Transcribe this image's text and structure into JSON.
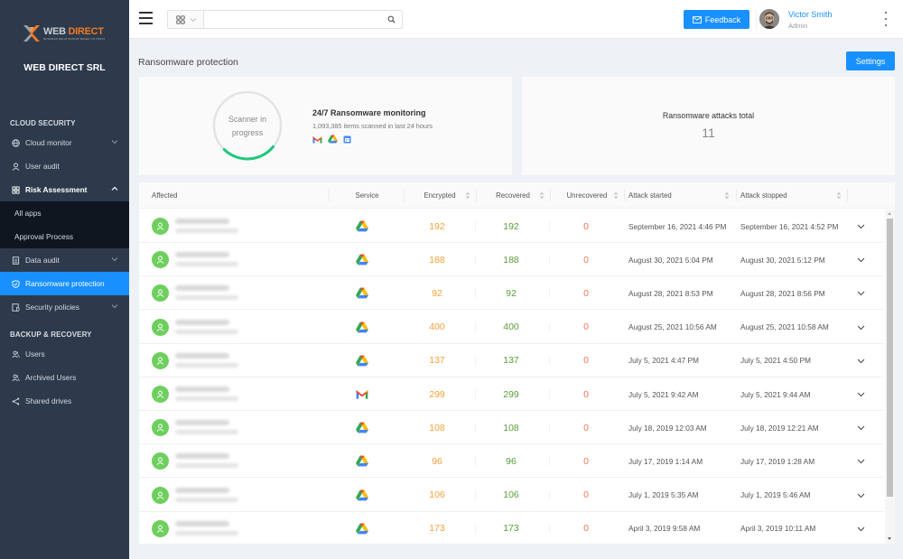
{
  "brand": {
    "logo_text_web": "WEB",
    "logo_text_direct": "DIRECT",
    "logo_tagline": "BUSINESS RELATIONSHIP BASED ON TRUST",
    "company_name": "WEB DIRECT SRL",
    "accent_color": "#1890ff",
    "logo_orange": "#f07a24"
  },
  "sidebar": {
    "sections": [
      {
        "label": "CLOUD SECURITY"
      },
      {
        "label": "BACKUP & RECOVERY"
      }
    ],
    "items": [
      {
        "label": "Cloud monitor",
        "icon": "globe-icon",
        "has_chevron": true
      },
      {
        "label": "User audit",
        "icon": "user-icon",
        "has_chevron": false
      },
      {
        "label": "Risk Assessment",
        "icon": "grid-icon",
        "has_chevron": true,
        "expanded": true
      },
      {
        "label": "Data audit",
        "icon": "document-icon",
        "has_chevron": true
      },
      {
        "label": "Ransomware protection",
        "icon": "shield-icon",
        "active": true
      },
      {
        "label": "Security policies",
        "icon": "policy-icon",
        "has_chevron": true
      },
      {
        "label": "Users",
        "icon": "users-icon"
      },
      {
        "label": "Archived Users",
        "icon": "archived-users-icon"
      },
      {
        "label": "Shared drives",
        "icon": "share-icon"
      }
    ],
    "sub_items": [
      {
        "label": "All apps"
      },
      {
        "label": "Approval Process"
      }
    ]
  },
  "topbar": {
    "search_placeholder": "",
    "search_value": "",
    "feedback_label": "Feedback",
    "user_name": "Victor Smith",
    "user_role": "Admin"
  },
  "page": {
    "title": "Ransomware protection",
    "settings_label": "Settings"
  },
  "monitor_card": {
    "ring_line1": "Scanner in",
    "ring_line2": "progress",
    "title": "24/7 Ransomware monitoring",
    "subtitle": "1,093,385 items scanned in last 24 hours",
    "services": [
      "gmail-icon",
      "google-drive-icon",
      "calendar-icon"
    ]
  },
  "attacks_card": {
    "title": "Ransomware attacks total",
    "count": "11"
  },
  "table": {
    "columns": [
      "Affected",
      "Service",
      "Encrypted",
      "Recovered",
      "Unrecovered",
      "Attack started",
      "Attack stopped"
    ],
    "rows": [
      {
        "service": "drive",
        "encrypted": "192",
        "recovered": "192",
        "unrecovered": "0",
        "started": "September 16, 2021 4:46 PM",
        "stopped": "September 16, 2021 4:52 PM"
      },
      {
        "service": "drive",
        "encrypted": "188",
        "recovered": "188",
        "unrecovered": "0",
        "started": "August 30, 2021 5:04 PM",
        "stopped": "August 30, 2021 5:12 PM"
      },
      {
        "service": "drive",
        "encrypted": "92",
        "recovered": "92",
        "unrecovered": "0",
        "started": "August 28, 2021 8:53 PM",
        "stopped": "August 28, 2021 8:56 PM"
      },
      {
        "service": "drive",
        "encrypted": "400",
        "recovered": "400",
        "unrecovered": "0",
        "started": "August 25, 2021 10:56 AM",
        "stopped": "August 25, 2021 10:58 AM"
      },
      {
        "service": "drive",
        "encrypted": "137",
        "recovered": "137",
        "unrecovered": "0",
        "started": "July 5, 2021 4:47 PM",
        "stopped": "July 5, 2021 4:50 PM"
      },
      {
        "service": "gmail",
        "encrypted": "299",
        "recovered": "299",
        "unrecovered": "0",
        "started": "July 5, 2021 9:42 AM",
        "stopped": "July 5, 2021 9:44 AM"
      },
      {
        "service": "drive",
        "encrypted": "108",
        "recovered": "108",
        "unrecovered": "0",
        "started": "July 18, 2019 12:03 AM",
        "stopped": "July 18, 2019 12:21 AM"
      },
      {
        "service": "drive",
        "encrypted": "96",
        "recovered": "96",
        "unrecovered": "0",
        "started": "July 17, 2019 1:14 AM",
        "stopped": "July 17, 2019 1:28 AM"
      },
      {
        "service": "drive",
        "encrypted": "106",
        "recovered": "106",
        "unrecovered": "0",
        "started": "July 1, 2019 5:35 AM",
        "stopped": "July 1, 2019 5:46 AM"
      },
      {
        "service": "drive",
        "encrypted": "173",
        "recovered": "173",
        "unrecovered": "0",
        "started": "April 3, 2019 9:58 AM",
        "stopped": "April 3, 2019 10:11 AM"
      }
    ],
    "colors": {
      "encrypted": "#f5a03a",
      "recovered": "#5a9e3b",
      "unrecovered": "#f0754f"
    }
  }
}
